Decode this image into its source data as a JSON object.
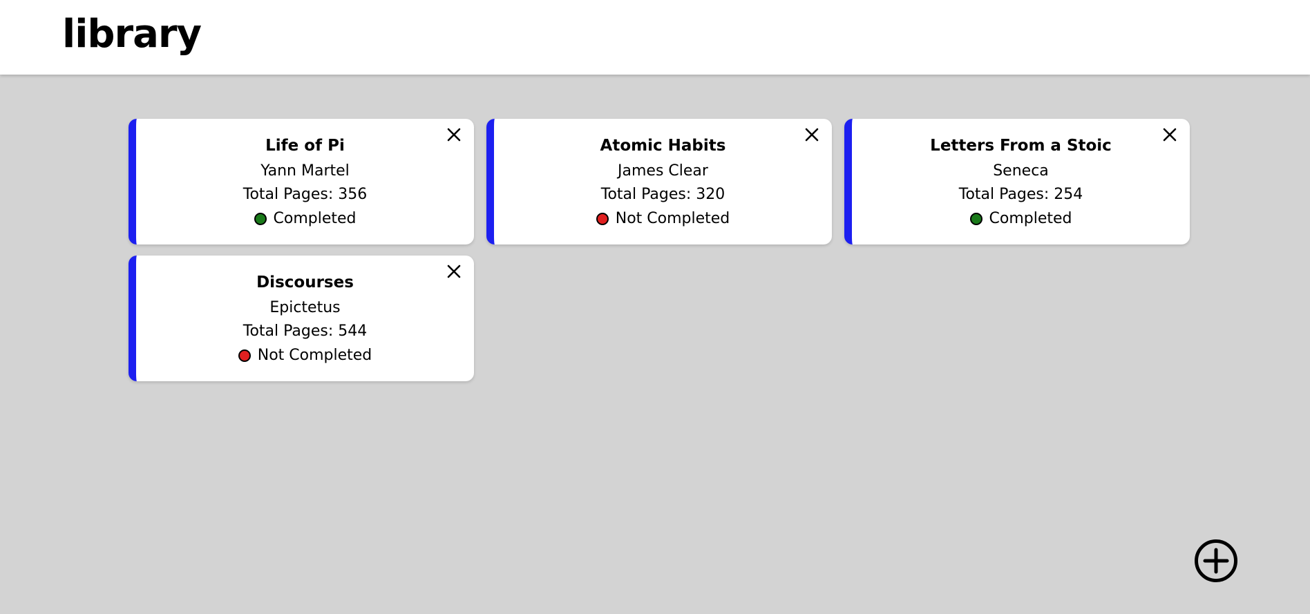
{
  "header": {
    "title": "library"
  },
  "books": [
    {
      "title": "Life of Pi",
      "author": "Yann Martel",
      "pages_text": "Total Pages: 356",
      "status": "Completed",
      "status_color": "#1a7a1a"
    },
    {
      "title": "Atomic Habits",
      "author": "James Clear",
      "pages_text": "Total Pages: 320",
      "status": "Not Completed",
      "status_color": "#e02020"
    },
    {
      "title": "Letters From a Stoic",
      "author": "Seneca",
      "pages_text": "Total Pages: 254",
      "status": "Completed",
      "status_color": "#1a7a1a"
    },
    {
      "title": "Discourses",
      "author": "Epictetus",
      "pages_text": "Total Pages: 544",
      "status": "Not Completed",
      "status_color": "#e02020"
    }
  ],
  "icons": {
    "card_close": "close-icon",
    "add": "plus-circle-icon"
  },
  "colors": {
    "accent": "#1c1ff0",
    "background": "#d3d3d3",
    "card": "#ffffff",
    "completed": "#1a7a1a",
    "not_completed": "#e02020"
  }
}
